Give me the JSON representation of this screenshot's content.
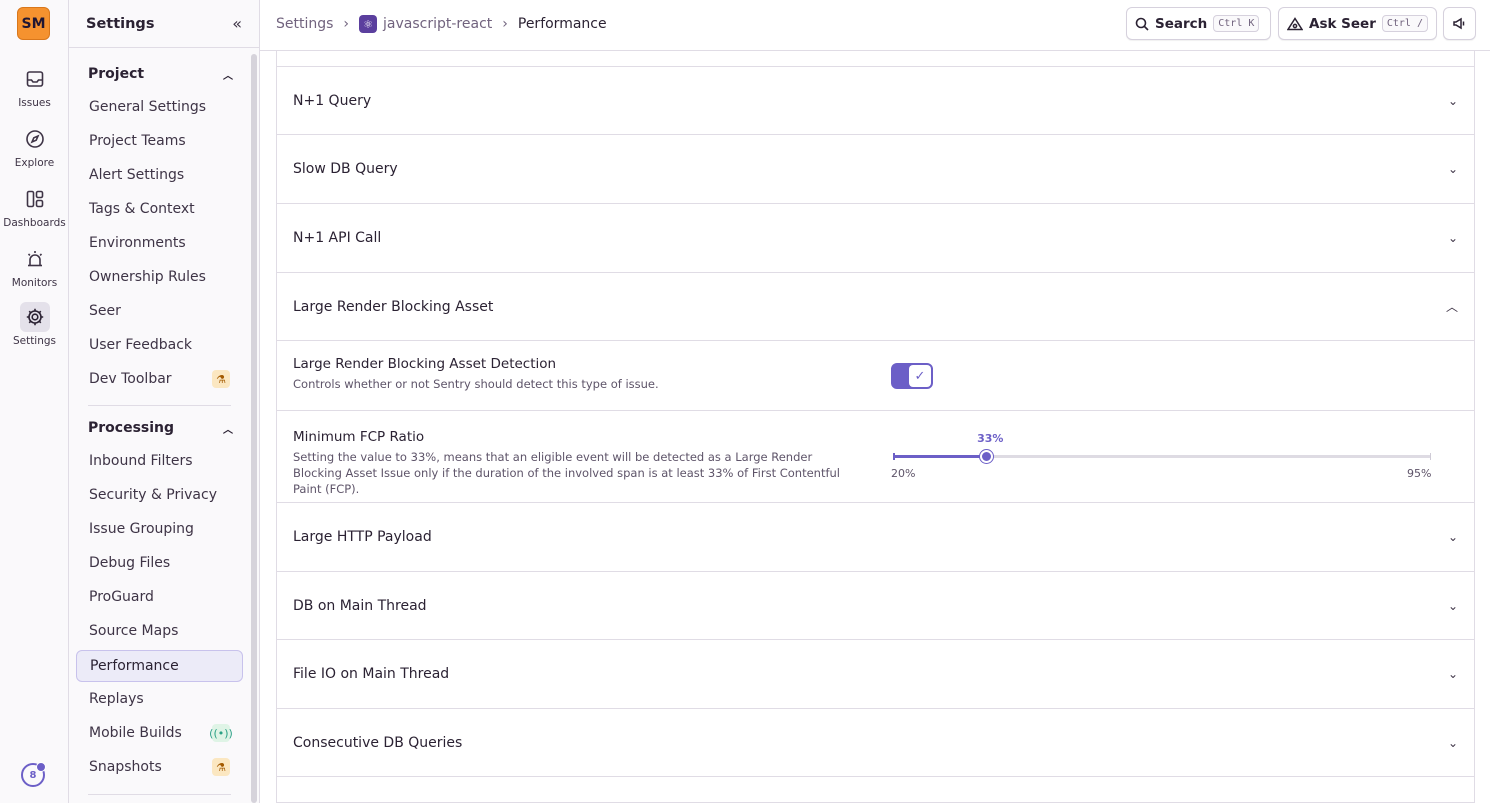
{
  "rail": {
    "org_initials": "SM",
    "items": [
      {
        "label": "Issues",
        "icon": "inbox-icon"
      },
      {
        "label": "Explore",
        "icon": "compass-icon"
      },
      {
        "label": "Dashboards",
        "icon": "dashboard-icon"
      },
      {
        "label": "Monitors",
        "icon": "siren-icon"
      },
      {
        "label": "Settings",
        "icon": "gear-icon",
        "active": true
      }
    ],
    "bottom_badge": "8"
  },
  "sidebar": {
    "title": "Settings",
    "sections": [
      {
        "title": "Project",
        "items": [
          {
            "label": "General Settings"
          },
          {
            "label": "Project Teams"
          },
          {
            "label": "Alert Settings"
          },
          {
            "label": "Tags & Context"
          },
          {
            "label": "Environments"
          },
          {
            "label": "Ownership Rules"
          },
          {
            "label": "Seer"
          },
          {
            "label": "User Feedback"
          },
          {
            "label": "Dev Toolbar",
            "badge": "beta"
          }
        ]
      },
      {
        "title": "Processing",
        "items": [
          {
            "label": "Inbound Filters"
          },
          {
            "label": "Security & Privacy"
          },
          {
            "label": "Issue Grouping"
          },
          {
            "label": "Debug Files"
          },
          {
            "label": "ProGuard"
          },
          {
            "label": "Source Maps"
          },
          {
            "label": "Performance",
            "active": true
          },
          {
            "label": "Replays"
          },
          {
            "label": "Mobile Builds",
            "badge": "new"
          },
          {
            "label": "Snapshots",
            "badge": "beta"
          }
        ]
      }
    ]
  },
  "topbar": {
    "breadcrumb": [
      "Settings",
      "javascript-react",
      "Performance"
    ],
    "search_label": "Search",
    "search_kbd": "Ctrl K",
    "ask_label": "Ask Seer",
    "ask_kbd": "Ctrl /"
  },
  "panels": {
    "n1_query": "N+1 Query",
    "slow_db": "Slow DB Query",
    "n1_api": "N+1 API Call",
    "large_render": "Large Render Blocking Asset",
    "detection_label": "Large Render Blocking Asset Detection",
    "detection_help": "Controls whether or not Sentry should detect this type of issue.",
    "detection_enabled": true,
    "fcp_label": "Minimum FCP Ratio",
    "fcp_help": "Setting the value to 33%, means that an eligible event will be detected as a Large Render Blocking Asset Issue only if the duration of the involved span is at least 33% of First Contentful Paint (FCP).",
    "fcp_value": 33,
    "fcp_value_label": "33%",
    "fcp_min": 20,
    "fcp_min_label": "20%",
    "fcp_max": 95,
    "fcp_max_label": "95%",
    "large_http": "Large HTTP Payload",
    "db_main": "DB on Main Thread",
    "file_io": "File IO on Main Thread",
    "consecutive_db": "Consecutive DB Queries"
  },
  "colors": {
    "accent": "#6c5fc7",
    "org_badge": "#f5922f"
  }
}
